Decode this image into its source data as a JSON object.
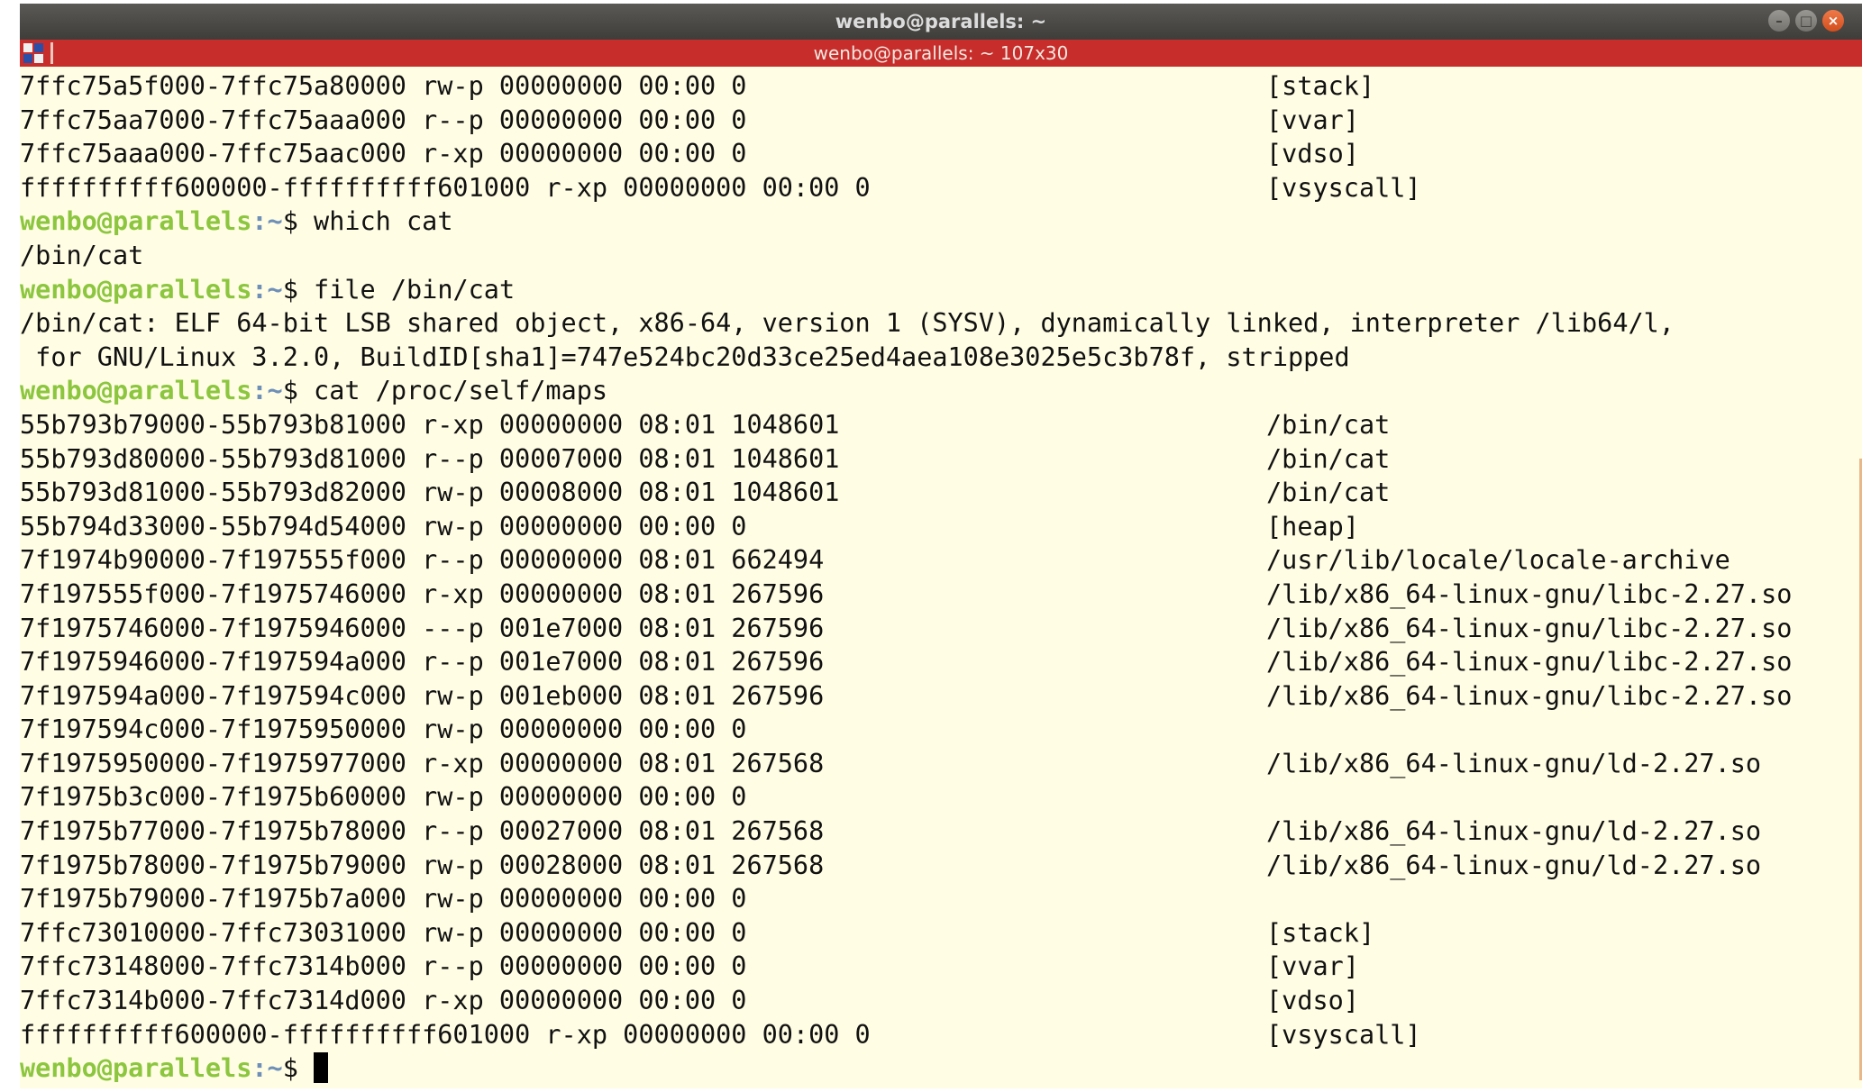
{
  "window": {
    "title": "wenbo@parallels: ~",
    "tab_title": "wenbo@parallels: ~ 107x30"
  },
  "controls": {
    "minimize": "–",
    "maximize": "□",
    "close": "×"
  },
  "prompt": {
    "user": "wenbo@parallels",
    "path": ":~",
    "symbol": "$ "
  },
  "colors": {
    "terminal_bg": "#fffde4",
    "tab_bar": "#c72d2b",
    "prompt_user": "#8cc63f",
    "prompt_path": "#6e8fb8"
  },
  "lines": [
    {
      "type": "map",
      "text": "7ffc75a5f000-7ffc75a80000 rw-p 00000000 00:00 0",
      "path": "[stack]"
    },
    {
      "type": "map",
      "text": "7ffc75aa7000-7ffc75aaa000 r--p 00000000 00:00 0",
      "path": "[vvar]"
    },
    {
      "type": "map",
      "text": "7ffc75aaa000-7ffc75aac000 r-xp 00000000 00:00 0",
      "path": "[vdso]"
    },
    {
      "type": "map",
      "text": "ffffffffff600000-ffffffffff601000 r-xp 00000000 00:00 0",
      "path": "[vsyscall]"
    },
    {
      "type": "cmd",
      "text": "which cat"
    },
    {
      "type": "out",
      "text": "/bin/cat"
    },
    {
      "type": "cmd",
      "text": "file /bin/cat"
    },
    {
      "type": "out",
      "text": "/bin/cat: ELF 64-bit LSB shared object, x86-64, version 1 (SYSV), dynamically linked, interpreter /lib64/l,"
    },
    {
      "type": "out",
      "text": " for GNU/Linux 3.2.0, BuildID[sha1]=747e524bc20d33ce25ed4aea108e3025e5c3b78f, stripped"
    },
    {
      "type": "cmd",
      "text": "cat /proc/self/maps"
    },
    {
      "type": "map",
      "text": "55b793b79000-55b793b81000 r-xp 00000000 08:01 1048601",
      "path": "/bin/cat"
    },
    {
      "type": "map",
      "text": "55b793d80000-55b793d81000 r--p 00007000 08:01 1048601",
      "path": "/bin/cat"
    },
    {
      "type": "map",
      "text": "55b793d81000-55b793d82000 rw-p 00008000 08:01 1048601",
      "path": "/bin/cat"
    },
    {
      "type": "map",
      "text": "55b794d33000-55b794d54000 rw-p 00000000 00:00 0",
      "path": "[heap]"
    },
    {
      "type": "map",
      "text": "7f1974b90000-7f197555f000 r--p 00000000 08:01 662494",
      "path": "/usr/lib/locale/locale-archive"
    },
    {
      "type": "map",
      "text": "7f197555f000-7f1975746000 r-xp 00000000 08:01 267596",
      "path": "/lib/x86_64-linux-gnu/libc-2.27.so"
    },
    {
      "type": "map",
      "text": "7f1975746000-7f1975946000 ---p 001e7000 08:01 267596",
      "path": "/lib/x86_64-linux-gnu/libc-2.27.so"
    },
    {
      "type": "map",
      "text": "7f1975946000-7f197594a000 r--p 001e7000 08:01 267596",
      "path": "/lib/x86_64-linux-gnu/libc-2.27.so"
    },
    {
      "type": "map",
      "text": "7f197594a000-7f197594c000 rw-p 001eb000 08:01 267596",
      "path": "/lib/x86_64-linux-gnu/libc-2.27.so"
    },
    {
      "type": "map",
      "text": "7f197594c000-7f1975950000 rw-p 00000000 00:00 0",
      "path": ""
    },
    {
      "type": "map",
      "text": "7f1975950000-7f1975977000 r-xp 00000000 08:01 267568",
      "path": "/lib/x86_64-linux-gnu/ld-2.27.so"
    },
    {
      "type": "map",
      "text": "7f1975b3c000-7f1975b60000 rw-p 00000000 00:00 0",
      "path": ""
    },
    {
      "type": "map",
      "text": "7f1975b77000-7f1975b78000 r--p 00027000 08:01 267568",
      "path": "/lib/x86_64-linux-gnu/ld-2.27.so"
    },
    {
      "type": "map",
      "text": "7f1975b78000-7f1975b79000 rw-p 00028000 08:01 267568",
      "path": "/lib/x86_64-linux-gnu/ld-2.27.so"
    },
    {
      "type": "map",
      "text": "7f1975b79000-7f1975b7a000 rw-p 00000000 00:00 0",
      "path": ""
    },
    {
      "type": "map",
      "text": "7ffc73010000-7ffc73031000 rw-p 00000000 00:00 0",
      "path": "[stack]"
    },
    {
      "type": "map",
      "text": "7ffc73148000-7ffc7314b000 r--p 00000000 00:00 0",
      "path": "[vvar]"
    },
    {
      "type": "map",
      "text": "7ffc7314b000-7ffc7314d000 r-xp 00000000 00:00 0",
      "path": "[vdso]"
    },
    {
      "type": "map",
      "text": "ffffffffff600000-ffffffffff601000 r-xp 00000000 00:00 0",
      "path": "[vsyscall]"
    },
    {
      "type": "prompt",
      "text": ""
    }
  ]
}
